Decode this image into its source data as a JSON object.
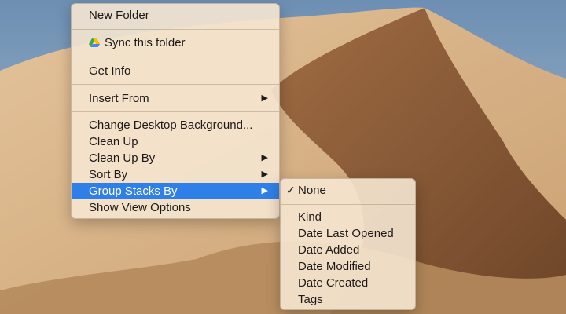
{
  "context_menu": {
    "new_folder": "New Folder",
    "sync_folder": "Sync this folder",
    "get_info": "Get Info",
    "insert_from": "Insert From",
    "change_background": "Change Desktop Background...",
    "clean_up": "Clean Up",
    "clean_up_by": "Clean Up By",
    "sort_by": "Sort By",
    "group_stacks_by": "Group Stacks By",
    "show_view_options": "Show View Options",
    "submenu_arrow": "▶"
  },
  "group_stacks_submenu": {
    "checkmark": "✓",
    "none": "None",
    "items": [
      "Kind",
      "Date Last Opened",
      "Date Added",
      "Date Modified",
      "Date Created",
      "Tags"
    ]
  },
  "colors": {
    "selection": "#2f7fe8",
    "menu_background": "#f5e6d0"
  },
  "icons": {
    "sync": "google-drive-icon"
  }
}
